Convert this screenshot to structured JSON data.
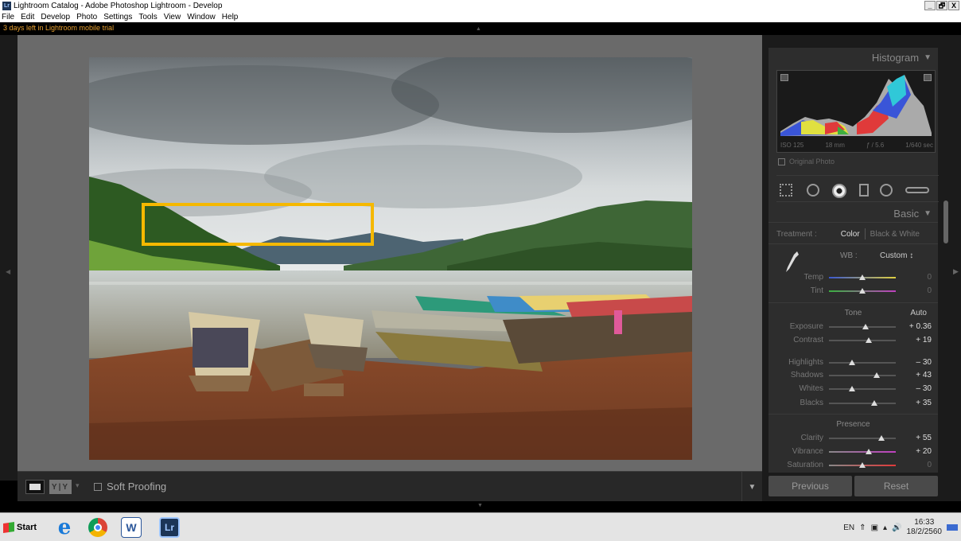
{
  "window": {
    "title": "Lightroom Catalog - Adobe Photoshop Lightroom - Develop",
    "app_icon_text": "Lr",
    "controls": [
      "_",
      "Ő",
      "X"
    ]
  },
  "menu": [
    "File",
    "Edit",
    "Develop",
    "Photo",
    "Settings",
    "Tools",
    "View",
    "Window",
    "Help"
  ],
  "trial_notice": "3 days left in Lightroom mobile trial",
  "toolbar": {
    "yy_label": "Y|Y",
    "soft_proofing_label": "Soft Proofing",
    "soft_proofing_checked": false
  },
  "histogram": {
    "header": "Histogram",
    "iso": "ISO 125",
    "focal": "18 mm",
    "aperture": "ƒ / 5.6",
    "shutter": "1/640 sec",
    "original_photo_label": "Original Photo"
  },
  "basic": {
    "header": "Basic",
    "treatment_label": "Treatment :",
    "treatment_color": "Color",
    "treatment_bw": "Black & White",
    "wb_label": "WB :",
    "wb_value": "Custom ↕",
    "tone_label": "Tone",
    "auto_label": "Auto",
    "presence_label": "Presence",
    "sliders": {
      "temp": {
        "label": "Temp",
        "value": "0",
        "level": 0.5
      },
      "tint": {
        "label": "Tint",
        "value": "0",
        "level": 0.5
      },
      "exposure": {
        "label": "Exposure",
        "value": "+ 0.36",
        "level": 0.55
      },
      "contrast": {
        "label": "Contrast",
        "value": "+ 19",
        "level": 0.6
      },
      "highlights": {
        "label": "Highlights",
        "value": "– 30",
        "level": 0.35
      },
      "shadows": {
        "label": "Shadows",
        "value": "+ 43",
        "level": 0.72
      },
      "whites": {
        "label": "Whites",
        "value": "– 30",
        "level": 0.35
      },
      "blacks": {
        "label": "Blacks",
        "value": "+ 35",
        "level": 0.68
      },
      "clarity": {
        "label": "Clarity",
        "value": "+ 55",
        "level": 0.78
      },
      "vibrance": {
        "label": "Vibrance",
        "value": "+ 20",
        "level": 0.6
      },
      "saturation": {
        "label": "Saturation",
        "value": "0",
        "level": 0.5
      }
    }
  },
  "buttons": {
    "previous": "Previous",
    "reset": "Reset"
  },
  "taskbar": {
    "start": "Start",
    "word_label": "W",
    "lr_label": "Lr",
    "lang": "EN",
    "time": "16:33",
    "date": "18/2/2560"
  },
  "colors": {
    "highlight_box": "#f5b800",
    "trial_text": "#e8a030"
  }
}
